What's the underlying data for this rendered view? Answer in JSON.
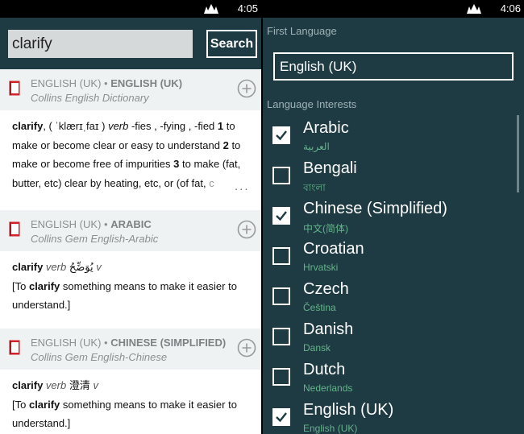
{
  "left": {
    "status": {
      "time": "4:05"
    },
    "search": {
      "value": "clarify",
      "button": "Search"
    },
    "dictionaries": [
      {
        "lang_a": "ENGLISH (UK)",
        "sep": " • ",
        "lang_b": "ENGLISH (UK)",
        "source": "Collins English Dictionary"
      },
      {
        "lang_a": "ENGLISH (UK)",
        "sep": " • ",
        "lang_b": "ARABIC",
        "source": "Collins Gem English-Arabic"
      },
      {
        "lang_a": "ENGLISH (UK)",
        "sep": " • ",
        "lang_b": "CHINESE (SIMPLIFIED)",
        "source": "Collins Gem English-Chinese"
      }
    ],
    "entries": [
      {
        "head": "clarify",
        "pron": ", ( ˈklærɪˌfaɪ ) ",
        "pos": "verb",
        "infl": " -fies , -fying , -fied ",
        "n1": "1",
        "d1": " to make or become clear or easy to understand ",
        "n2": "2",
        "d2": " to make or become free of impurities ",
        "n3": "3",
        "d3": " to make (fat, butter, etc) clear by heating, etc, or (of fat, ",
        "tail": "c",
        "more": "..."
      },
      {
        "head": "clarify",
        "pos": " verb ",
        "translation": "يُوَضِّحُ",
        "suffix": " v",
        "ex_pre": "[To ",
        "ex_word": "clarify",
        "ex_post": " something means to make it easier to understand.]"
      },
      {
        "head": "clarify",
        "pos": " verb ",
        "translation": "澄清",
        "suffix": " v",
        "ex_pre": "[To ",
        "ex_word": "clarify",
        "ex_post": " something means to make it easier to understand.]"
      }
    ]
  },
  "right": {
    "status": {
      "time": "4:06"
    },
    "first_language_label": "First Language",
    "first_language_value": "English (UK)",
    "interests_label": "Language Interests",
    "languages": [
      {
        "name": "Arabic",
        "native": "العربية",
        "checked": true
      },
      {
        "name": "Bengali",
        "native": "বাংলা",
        "checked": false
      },
      {
        "name": "Chinese (Simplified)",
        "native": "中文(简体)",
        "checked": true
      },
      {
        "name": "Croatian",
        "native": "Hrvatski",
        "checked": false
      },
      {
        "name": "Czech",
        "native": "Čeština",
        "checked": false
      },
      {
        "name": "Danish",
        "native": "Dansk",
        "checked": false
      },
      {
        "name": "Dutch",
        "native": "Nederlands",
        "checked": false
      },
      {
        "name": "English (UK)",
        "native": "English (UK)",
        "checked": true
      }
    ]
  },
  "colors": {
    "panel": "#1e3a42",
    "native_text": "#62b58a",
    "header_bg": "#eff2f3",
    "book_red": "#d2232a"
  }
}
